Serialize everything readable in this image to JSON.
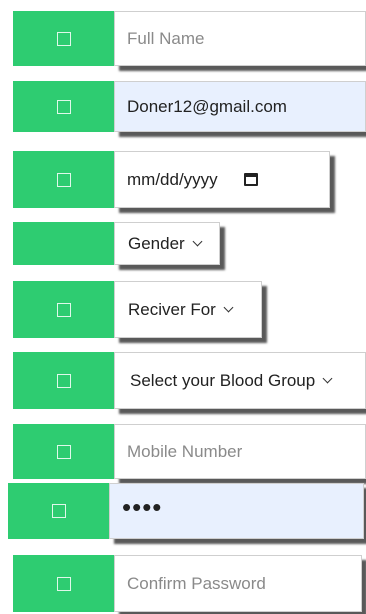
{
  "form": {
    "full_name": {
      "placeholder": "Full Name"
    },
    "email": {
      "value": "Doner12@gmail.com"
    },
    "dob": {
      "placeholder": "mm/dd/yyyy",
      "icon": "calendar-icon"
    },
    "gender": {
      "selected": "Gender"
    },
    "receiver_for": {
      "selected": "Reciver For"
    },
    "blood_group": {
      "selected": "Select your Blood Group"
    },
    "mobile": {
      "placeholder": "Mobile Number"
    },
    "password": {
      "masked_value": "••••"
    },
    "confirm_password": {
      "placeholder": "Confirm Password"
    }
  },
  "colors": {
    "addon_green": "#2ecc71",
    "autofill_blue": "#e8f0fe"
  },
  "icons": {
    "addon": "checkbox-icon",
    "select": "chevron-down-icon",
    "date": "calendar-icon"
  }
}
